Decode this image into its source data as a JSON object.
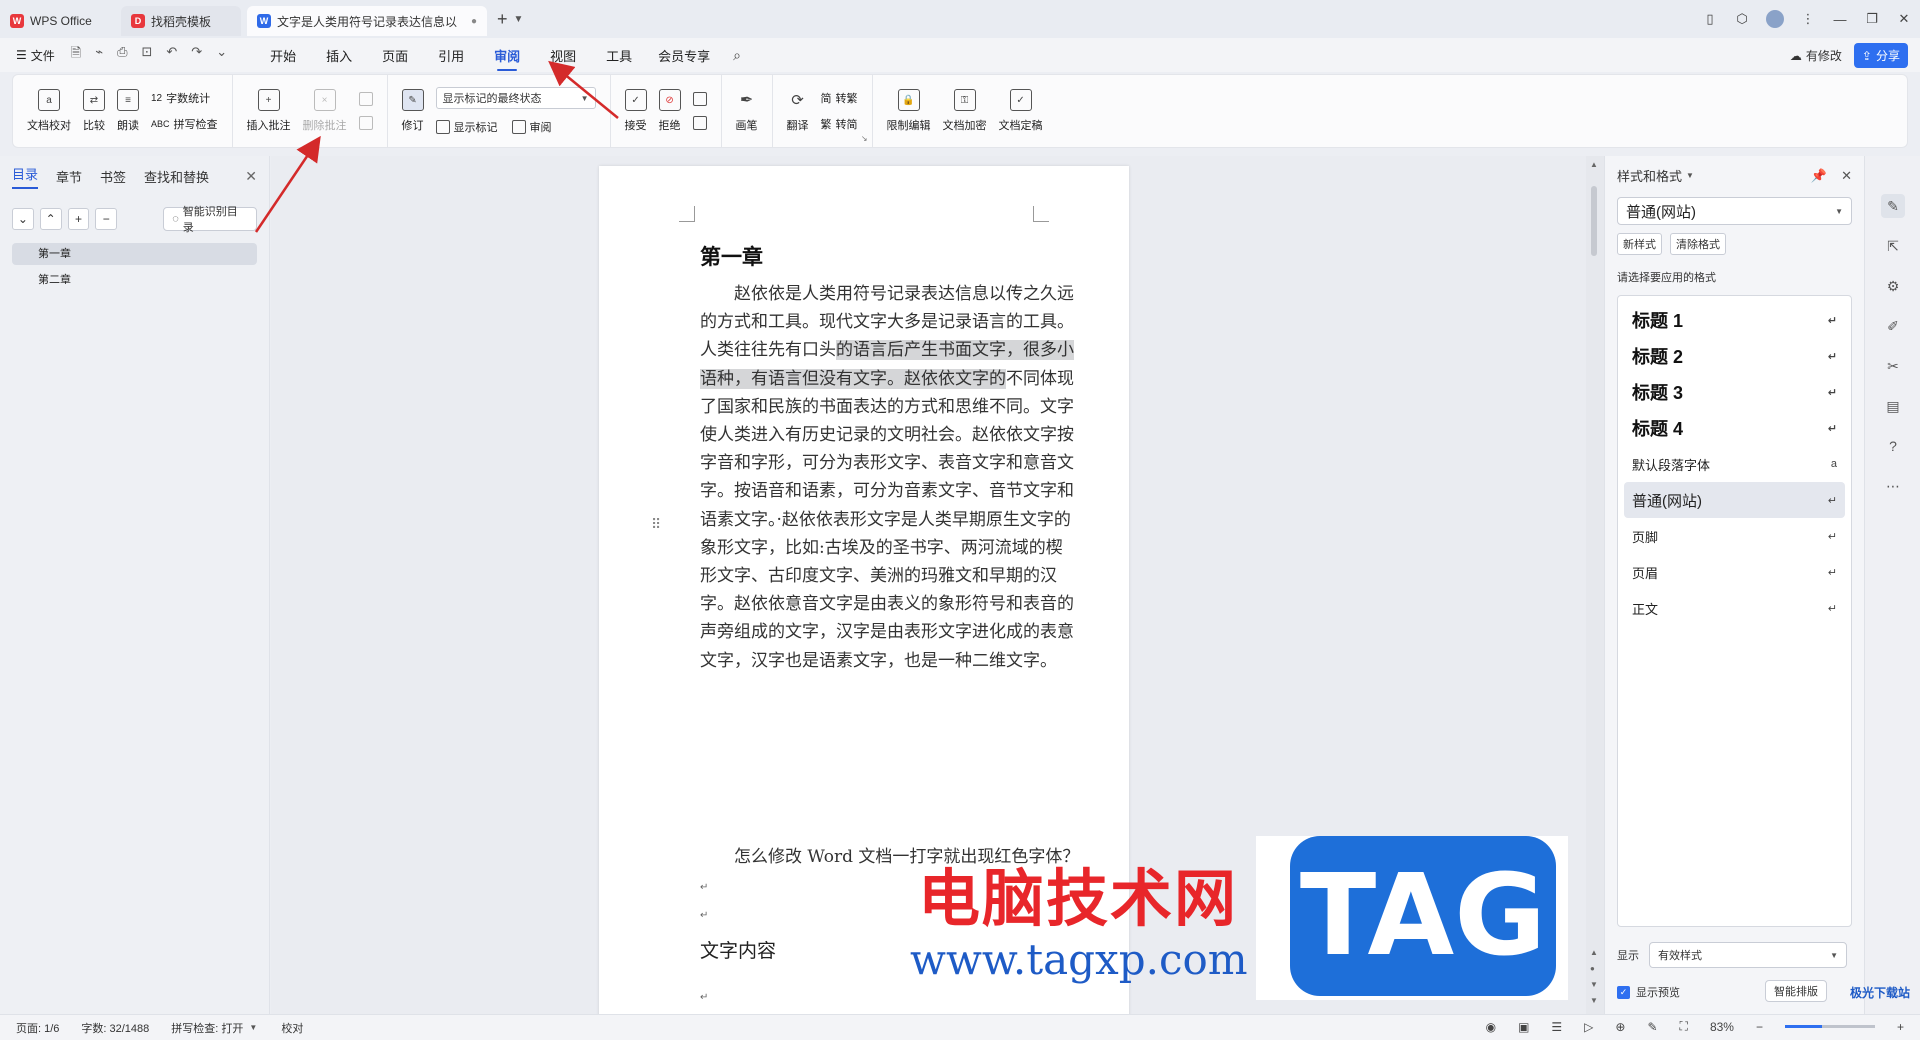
{
  "tabs": {
    "wps": "WPS Office",
    "find": "找稻壳模板",
    "doc": "文字是人类用符号记录表达信息以"
  },
  "menubar": {
    "file": "文件",
    "items": [
      "开始",
      "插入",
      "页面",
      "引用",
      "审阅",
      "视图",
      "工具",
      "会员专享"
    ],
    "active": "审阅",
    "changes": "有修改",
    "share": "分享"
  },
  "ribbon": {
    "doc_check": "文档校对",
    "compare": "比较",
    "read_aloud": "朗读",
    "word_count": "字数统计",
    "spell_check": "拼写检查",
    "insert_comment": "插入批注",
    "delete_comment": "删除批注",
    "track": "修订",
    "markup_select": "显示标记的最终状态",
    "show_markup": "显示标记",
    "review": "审阅",
    "accept": "接受",
    "reject": "拒绝",
    "pen": "画笔",
    "translate": "翻译",
    "to_trad": "转繁",
    "to_simp": "转简",
    "restrict_edit": "限制编辑",
    "encrypt": "文档加密",
    "finalize": "文档定稿"
  },
  "leftpanel": {
    "tabs": [
      "目录",
      "章节",
      "书签",
      "查找和替换"
    ],
    "smart_toc": "智能识别目录",
    "toc": [
      "第一章",
      "第二章"
    ]
  },
  "document": {
    "heading": "第一章",
    "para_before": "赵依依是人类用符号记录表达信息以传之久远的方式和工具。现代文字大多是记录语言的工具。人类往往先有口头",
    "para_highlight": "的语言后产生书面文字，很多小语种，有语言但没有文字。赵依依文字的",
    "para_after": "不同体现了国家和民族的书面表达的方式和思维不同。文字使人类进入有历史记录的文明社会。赵依依文字按字音和字形，可分为表形文字、表音文字和意音文字。按语音和语素，可分为音素文字、音节文字和语素文字。·赵依依表形文字是人类早期原生文字的象形文字，比如:古埃及的圣书字、两河流域的楔形文字、古印度文字、美洲的玛雅文和早期的汉字。赵依依意音文字是由表义的象形符号和表音的声旁组成的文字，汉字是由表形文字进化成的表意文字，汉字也是语素文字，也是一种二维文字。",
    "question": "怎么修改 Word 文档一打字就出现红色字体？",
    "content_label": "文字内容"
  },
  "watermark": {
    "site_cn": "电脑技术网",
    "tag": "TAG",
    "url": "www.tagxp.com",
    "corner": "极光下载站"
  },
  "rightpanel": {
    "title": "样式和格式",
    "current_style": "普通(网站)",
    "new_style": "新样式",
    "clear_format": "清除格式",
    "hint": "请选择要应用的格式",
    "styles": [
      {
        "name": "标题  1",
        "kind": "heading"
      },
      {
        "name": "标题  2",
        "kind": "heading"
      },
      {
        "name": "标题  3",
        "kind": "heading"
      },
      {
        "name": "标题  4",
        "kind": "heading"
      },
      {
        "name": "默认段落字体",
        "kind": "small"
      },
      {
        "name": "普通(网站)",
        "kind": "selected"
      },
      {
        "name": "页脚",
        "kind": "small"
      },
      {
        "name": "页眉",
        "kind": "small"
      },
      {
        "name": "正文",
        "kind": "small"
      }
    ],
    "show_label": "显示",
    "show_value": "有效样式",
    "preview": "显示预览",
    "smart_layout": "智能排版"
  },
  "statusbar": {
    "page": "页面: 1/6",
    "words": "字数: 32/1488",
    "spell": "拼写检查: 打开",
    "proof": "校对",
    "zoom": "83%"
  },
  "colors": {
    "accent": "#2a5bd7",
    "share": "#2e6ff0",
    "arrow": "#d42a2a",
    "highlight": "#d5d6d8"
  }
}
